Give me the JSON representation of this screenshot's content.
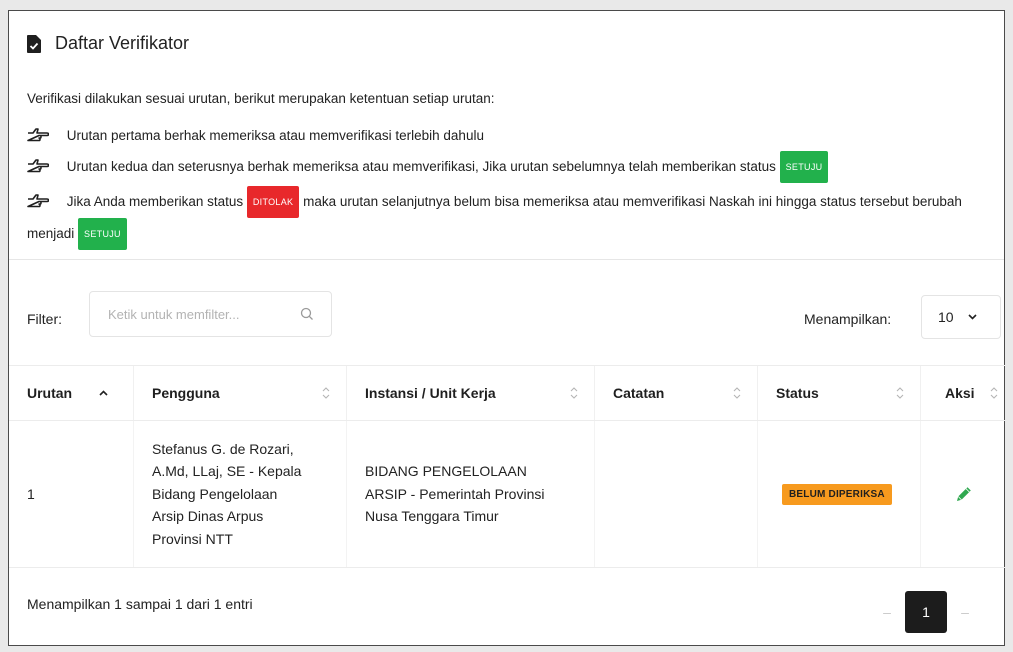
{
  "header": {
    "title": "Daftar Verifikator",
    "icon": "document-check-icon"
  },
  "intro": "Verifikasi dilakukan sesuai urutan, berikut merupakan ketentuan setiap urutan:",
  "rules": {
    "r1": {
      "text": "Urutan pertama berhak memeriksa atau memverifikasi terlebih dahulu"
    },
    "r2": {
      "text_before": "Urutan kedua dan seterusnya berhak memeriksa atau memverifikasi, Jika urutan sebelumnya telah memberikan status",
      "badge": "SETUJU"
    },
    "r3": {
      "text_before": "Jika Anda memberikan status",
      "badge_red": "DITOLAK",
      "text_middle": "maka urutan selanjutnya belum bisa memeriksa atau memverifikasi Naskah ini hingga status tersebut berubah menjadi",
      "badge_green": "SETUJU"
    }
  },
  "filter": {
    "label": "Filter:",
    "placeholder": "Ketik untuk memfilter..."
  },
  "page_size": {
    "label": "Menampilkan:",
    "value": "10"
  },
  "table": {
    "headers": {
      "urutan": "Urutan",
      "pengguna": "Pengguna",
      "instansi": "Instansi / Unit Kerja",
      "catatan": "Catatan",
      "status": "Status",
      "aksi": "Aksi"
    },
    "rows": [
      {
        "urutan": "1",
        "pengguna": "Stefanus G. de Rozari,\nA.Md, LLaj, SE - Kepala\nBidang Pengelolaan\nArsip Dinas Arpus\nProvinsi NTT",
        "instansi": "BIDANG PENGELOLAAN\nARSIP - Pemerintah Provinsi\nNusa Tenggara Timur",
        "catatan": "",
        "status": "BELUM DIPERIKSA"
      }
    ]
  },
  "footer": {
    "summary": "Menampilkan 1 sampai 1 dari 1 entri",
    "current_page": "1",
    "prev": "–",
    "next": "–"
  },
  "colors": {
    "green": "#22b14c",
    "red": "#e8282b",
    "orange": "#f79a1e",
    "edit": "#2fa84f"
  }
}
